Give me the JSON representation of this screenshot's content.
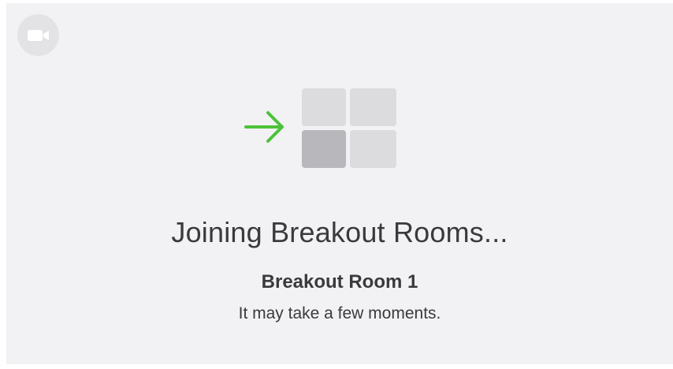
{
  "dialog": {
    "title": "Joining Breakout Rooms...",
    "room_name": "Breakout Room 1",
    "subtitle": "It may take a few moments."
  },
  "icons": {
    "app_badge": "video-camera-icon",
    "arrow": "arrow-right-icon",
    "grid": "breakout-rooms-grid-icon"
  },
  "colors": {
    "background": "#f2f2f4",
    "arrow": "#4cc23a",
    "tile_light": "#dcdcdf",
    "tile_dark": "#b8b8bc",
    "text": "#3a3a3c"
  }
}
